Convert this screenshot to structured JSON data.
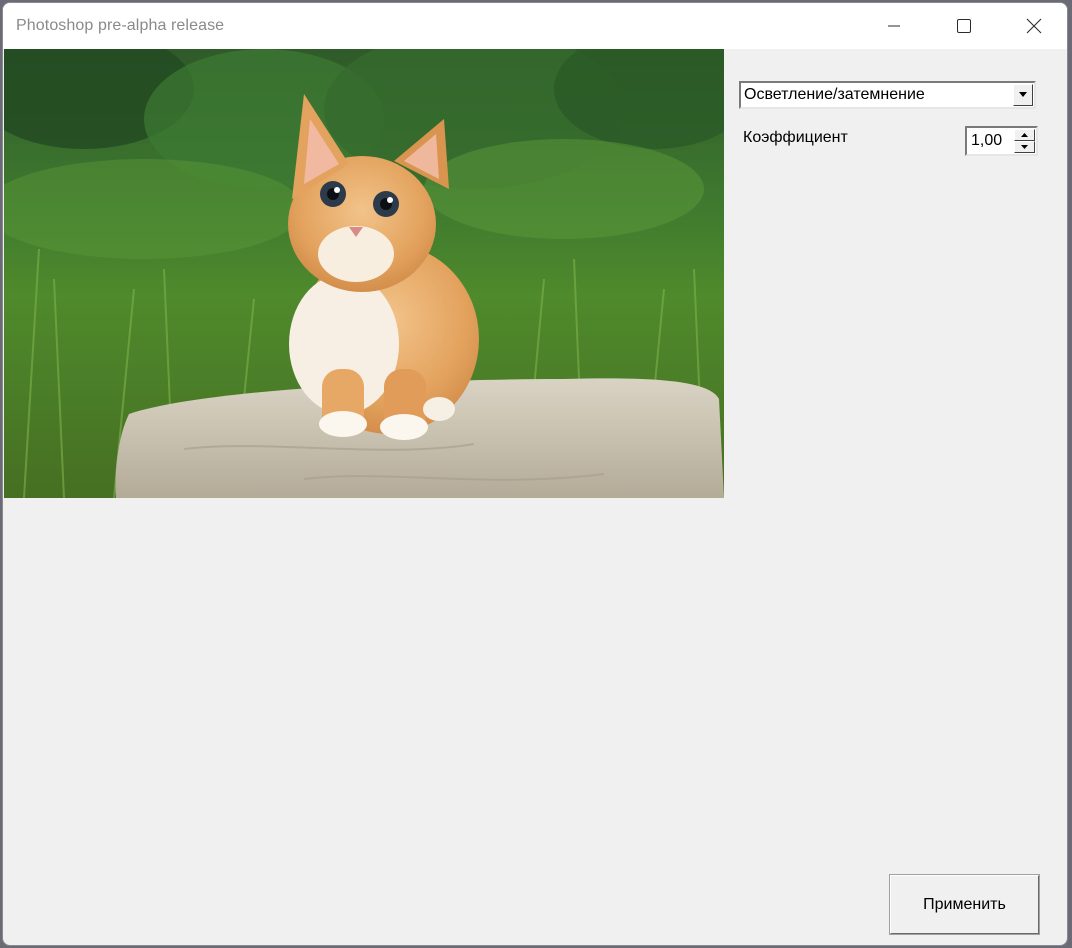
{
  "window": {
    "title": "Photoshop pre-alpha release"
  },
  "titlebar_icons": {
    "minimize": "minimize-icon",
    "maximize": "maximize-icon",
    "close": "close-icon"
  },
  "canvas": {
    "image_subject": "kitten-photo"
  },
  "controls": {
    "filter_selected": "Осветление/затемнение",
    "coefficient_label": "Коэффициент",
    "coefficient_value": "1,00"
  },
  "actions": {
    "apply_label": "Применить"
  }
}
